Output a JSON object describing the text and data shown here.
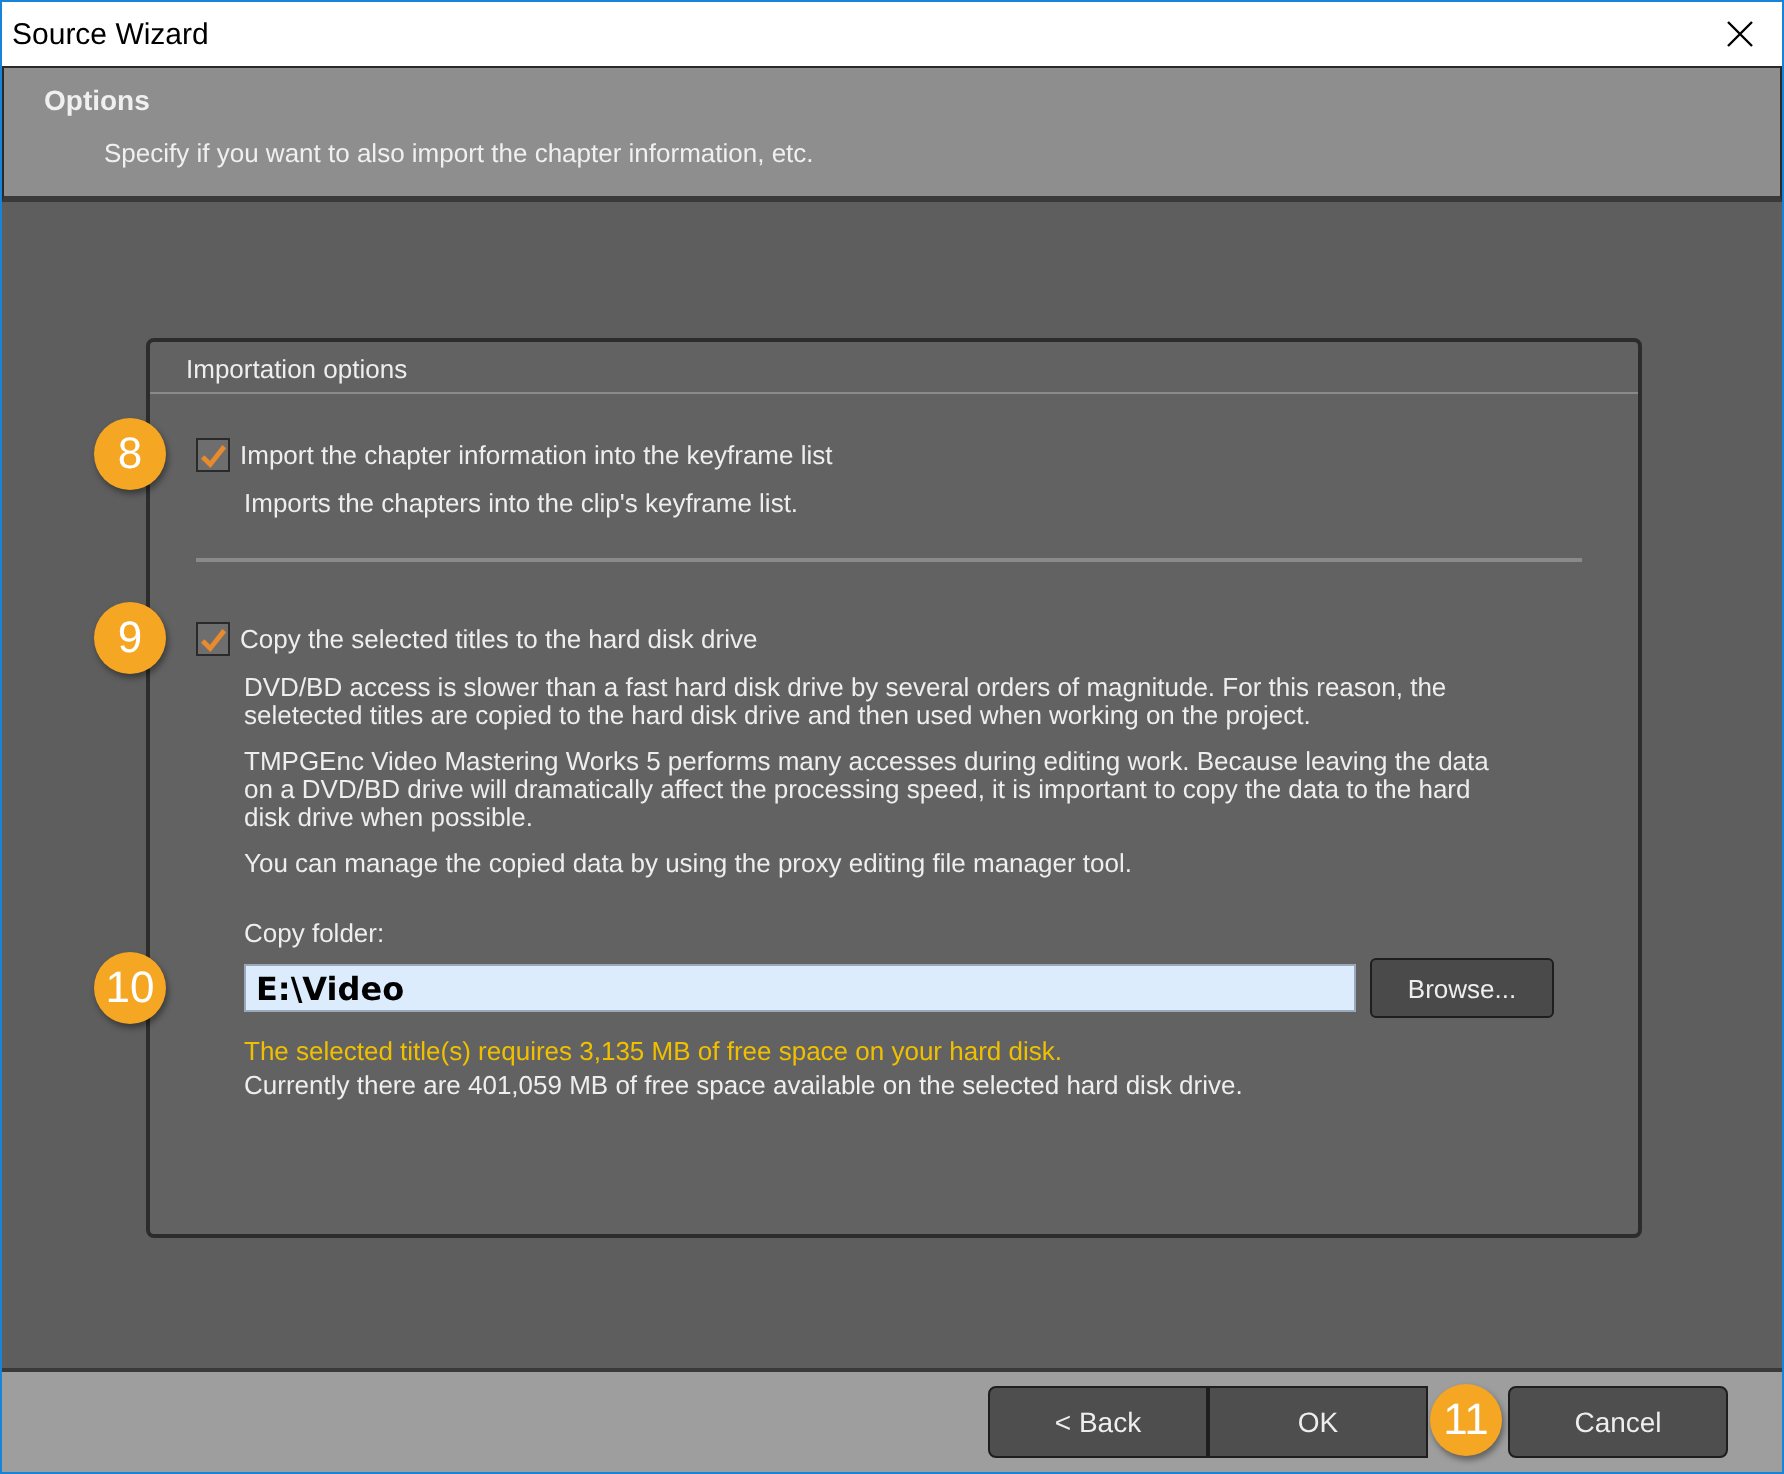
{
  "window": {
    "title": "Source Wizard"
  },
  "header": {
    "title": "Options",
    "description": "Specify if you want to also import the chapter information, etc."
  },
  "group": {
    "title": "Importation options",
    "options": [
      {
        "label": "Import the chapter information into the keyframe list",
        "checked": true,
        "badge": "8",
        "paragraphs": [
          "Imports the chapters into the clip's keyframe list."
        ]
      },
      {
        "label": "Copy the selected titles to the hard disk drive",
        "checked": true,
        "badge": "9",
        "paragraphs": [
          "DVD/BD access is slower than a fast hard disk drive by several orders of magnitude. For this reason, the seletected titles are copied to the hard disk drive and then used when working on the project.",
          "TMPGEnc Video Mastering Works 5 performs many accesses during editing work. Because leaving the data on a DVD/BD drive will dramatically affect the processing speed, it is important to copy the data to the hard disk drive when possible.",
          "You can manage the copied data by using the proxy editing file manager tool."
        ]
      }
    ]
  },
  "copy_folder": {
    "label": "Copy folder:",
    "value": "E:\\Video",
    "badge": "10",
    "browse": "Browse..."
  },
  "notes": [
    {
      "kind": "warning",
      "text": "The selected title(s) requires 3,135 MB of free space on your hard disk."
    },
    {
      "kind": "info",
      "text": "Currently there are 401,059 MB of free space available on the selected hard disk drive."
    }
  ],
  "buttons": [
    {
      "label": "< Back",
      "kind": "joined"
    },
    {
      "label": "OK",
      "kind": "joined",
      "badge": "11"
    },
    {
      "label": "Cancel",
      "kind": "separate"
    }
  ]
}
